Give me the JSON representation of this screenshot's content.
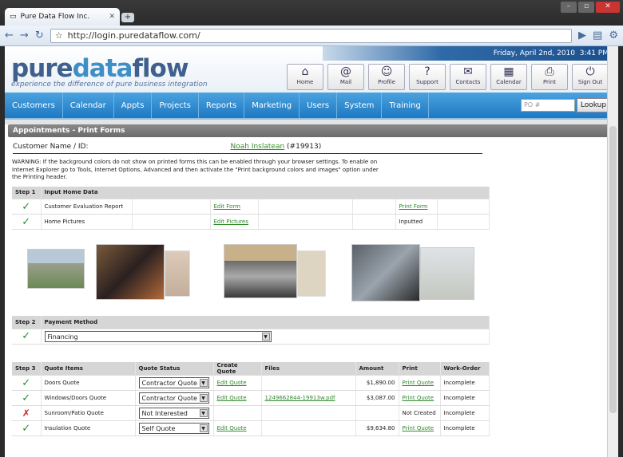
{
  "browser": {
    "tab_title": "Pure Data Flow Inc.",
    "url": "http://login.puredataflow.com/"
  },
  "header": {
    "date": "Friday, April 2nd, 2010",
    "time": "3:41 PM",
    "logo_pre": "pure",
    "logo_mid": "data",
    "logo_post": "flow",
    "tagline": "experience the difference of pure business integration",
    "icons": [
      {
        "label": "Home",
        "glyph": "⌂"
      },
      {
        "label": "Mail",
        "glyph": "@"
      },
      {
        "label": "Profile",
        "glyph": "☺"
      },
      {
        "label": "Support",
        "glyph": "?"
      },
      {
        "label": "Contacts",
        "glyph": "✉"
      },
      {
        "label": "Calendar",
        "glyph": "▦"
      },
      {
        "label": "Print",
        "glyph": "⎙"
      },
      {
        "label": "Sign Out",
        "glyph": "⏻"
      }
    ]
  },
  "menu": [
    "Customers",
    "Calendar",
    "Appts",
    "Projects",
    "Reports",
    "Marketing",
    "Users",
    "System",
    "Training"
  ],
  "search": {
    "placeholder": "PO #",
    "button": "Lookup"
  },
  "section_title": "Appointments - Print Forms",
  "customer": {
    "label": "Customer Name / ID:",
    "name": "Noah Inslatean",
    "id": "(#19913)"
  },
  "warning": "WARNING: If the background colors do not show on printed forms this can be enabled through your browser settings. To enable on Internet Explorer go to Tools, Internet Options, Advanced and then activate the \"Print background colors and images\" option under the Printing header.",
  "step1": {
    "step": "Step 1",
    "title": "Input Home Data",
    "rows": [
      {
        "label": "Customer Evaluation Report",
        "action": "Edit Form",
        "status": "Print Form"
      },
      {
        "label": "Home Pictures",
        "action": "Edit Pictures",
        "status": "Inputted"
      }
    ]
  },
  "step2": {
    "step": "Step 2",
    "title": "Payment Method",
    "value": "Financing"
  },
  "step3": {
    "step": "Step 3",
    "headers": [
      "Quote Items",
      "Quote Status",
      "Create Quote",
      "Files",
      "Amount",
      "Print",
      "Work-Order"
    ],
    "rows": [
      {
        "ok": true,
        "item": "Doors Quote",
        "status": "Contractor Quote",
        "create": "Edit Quote",
        "file": "",
        "amount": "$1,890.00",
        "print": "Print Quote",
        "wo": "Incomplete"
      },
      {
        "ok": true,
        "item": "Windows/Doors Quote",
        "status": "Contractor Quote",
        "create": "Edit Quote",
        "file": "1249662844-19913w.pdf",
        "amount": "$3,087.00",
        "print": "Print Quote",
        "wo": "Incomplete"
      },
      {
        "ok": false,
        "item": "Sunroom/Patio Quote",
        "status": "Not Interested",
        "create": "",
        "file": "",
        "amount": "",
        "print": "Not Created",
        "wo": "Incomplete"
      },
      {
        "ok": true,
        "item": "Insulation Quote",
        "status": "Self Quote",
        "create": "Edit Quote",
        "file": "",
        "amount": "$9,634.80",
        "print": "Print Quote",
        "wo": "Incomplete"
      }
    ]
  },
  "colors": {
    "menu": "#2a86cc",
    "accent_green": "#2f8a2a"
  }
}
